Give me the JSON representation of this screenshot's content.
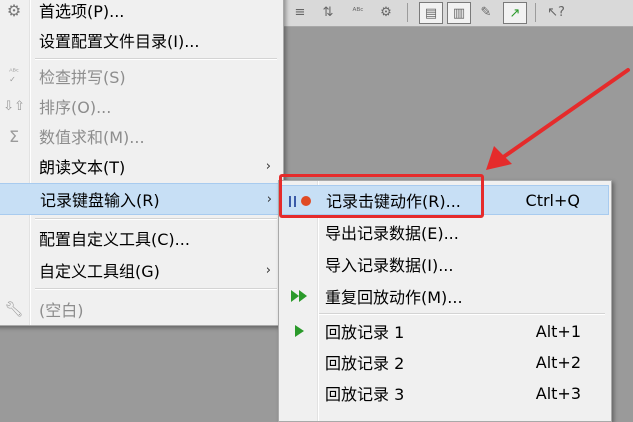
{
  "main_menu": {
    "items": [
      {
        "label": "首选项(P)...",
        "icon": "gear-icon",
        "enabled": true
      },
      {
        "label": "设置配置文件目录(I)...",
        "icon": "",
        "enabled": true
      },
      {
        "label": "检查拼写(S)",
        "icon": "spellcheck-icon",
        "enabled": false
      },
      {
        "label": "排序(O)...",
        "icon": "sort-icon",
        "enabled": false
      },
      {
        "label": "数值求和(M)...",
        "icon": "sigma-icon",
        "enabled": false
      },
      {
        "label": "朗读文本(T)",
        "icon": "",
        "enabled": true,
        "submenu": true
      },
      {
        "label": "记录键盘输入(R)",
        "icon": "",
        "enabled": true,
        "submenu": true,
        "highlighted": true
      },
      {
        "label": "配置自定义工具(C)...",
        "icon": "",
        "enabled": true
      },
      {
        "label": "自定义工具组(G)",
        "icon": "",
        "enabled": true,
        "submenu": true
      },
      {
        "label": "(空白)",
        "icon": "wrench-icon",
        "enabled": false
      }
    ]
  },
  "sub_menu": {
    "items": [
      {
        "label": "记录击键动作(R)...",
        "shortcut": "Ctrl+Q",
        "icon": "record-icon",
        "highlighted": true
      },
      {
        "label": "导出记录数据(E)...",
        "shortcut": "",
        "icon": ""
      },
      {
        "label": "导入记录数据(I)...",
        "shortcut": "",
        "icon": ""
      },
      {
        "label": "重复回放动作(M)...",
        "shortcut": "",
        "icon": "fast-forward-icon"
      },
      {
        "label": "回放记录 1",
        "shortcut": "Alt+1",
        "icon": "play-icon"
      },
      {
        "label": "回放记录 2",
        "shortcut": "Alt+2",
        "icon": ""
      },
      {
        "label": "回放记录 3",
        "shortcut": "Alt+3",
        "icon": ""
      }
    ]
  },
  "colors": {
    "highlight": "#c7dff5",
    "annotation": "#e52b2b",
    "play": "#2a9a2a",
    "record_dot": "#e04a24"
  }
}
